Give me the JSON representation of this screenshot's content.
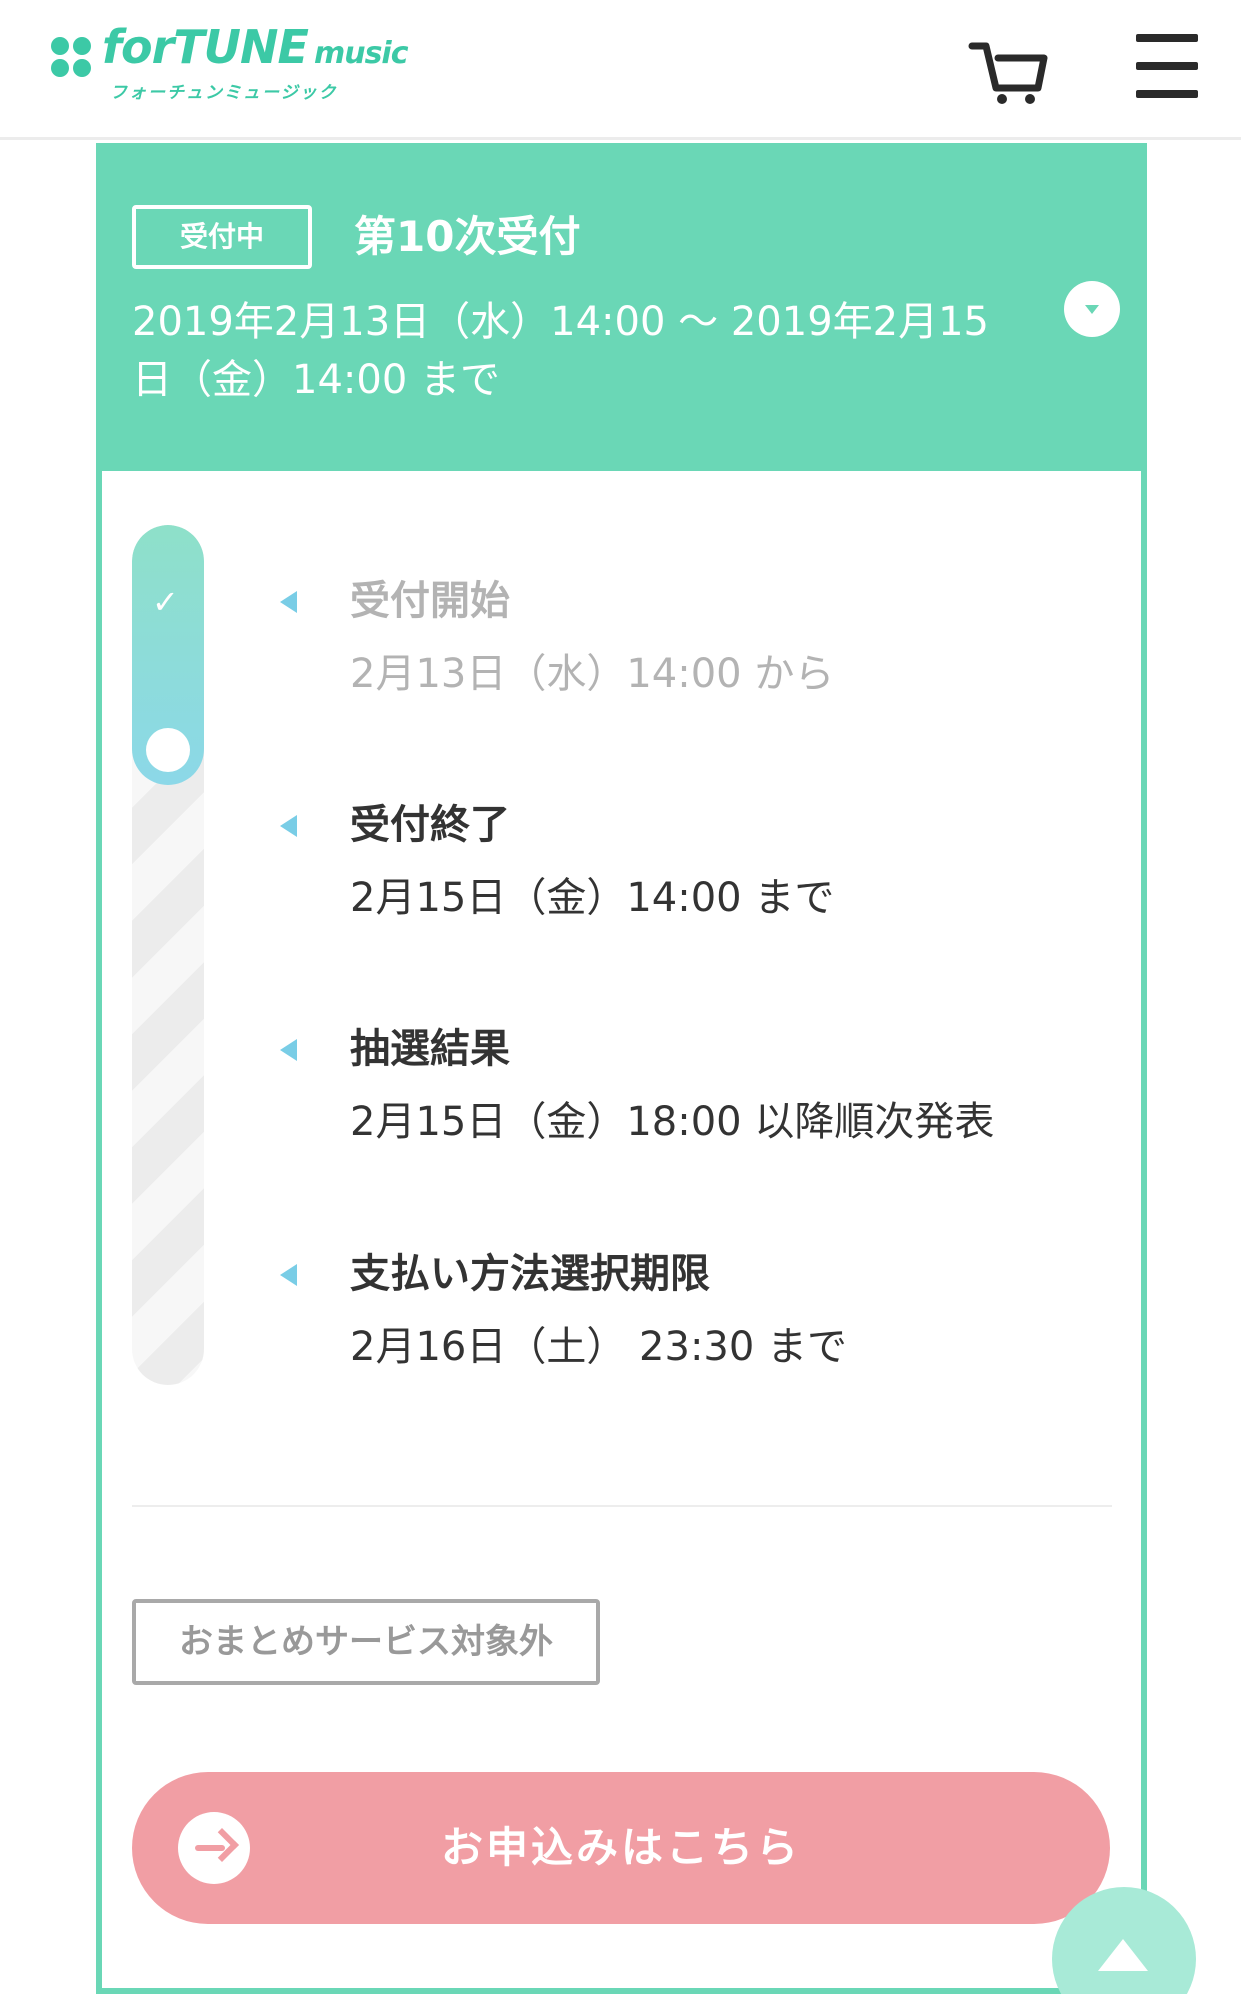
{
  "header": {
    "logo_text": "forTUNE",
    "logo_sub": "music",
    "logo_kana": "フォーチュンミュージック"
  },
  "application_round": {
    "status": "受付中",
    "title": "第10次受付",
    "period": "2019年2月13日（水）14:00 〜 2019年2月15日（金）14:00 まで"
  },
  "timeline": {
    "progress_fraction": 0.25,
    "steps": [
      {
        "label": "受付開始",
        "when": "2月13日（水）14:00 から",
        "done": true
      },
      {
        "label": "受付終了",
        "when": "2月15日（金）14:00 まで",
        "done": false
      },
      {
        "label": "抽選結果",
        "when": "2月15日（金）18:00 以降順次発表",
        "done": false
      },
      {
        "label": "支払い方法選択期限",
        "when": "2月16日（土） 23:30 まで",
        "done": false
      }
    ]
  },
  "bundle_tag": "おまとめサービス対象外",
  "apply_button": "お申込みはこちら",
  "colors": {
    "accent": "#6ad7b6",
    "apply": "#f19ea4",
    "timeline_arrow": "#79cde6"
  },
  "icons": [
    "clover-logo-icon",
    "cart-icon",
    "hamburger-menu-icon",
    "chevron-down-icon",
    "check-icon",
    "arrow-right-icon",
    "scroll-top-icon"
  ]
}
